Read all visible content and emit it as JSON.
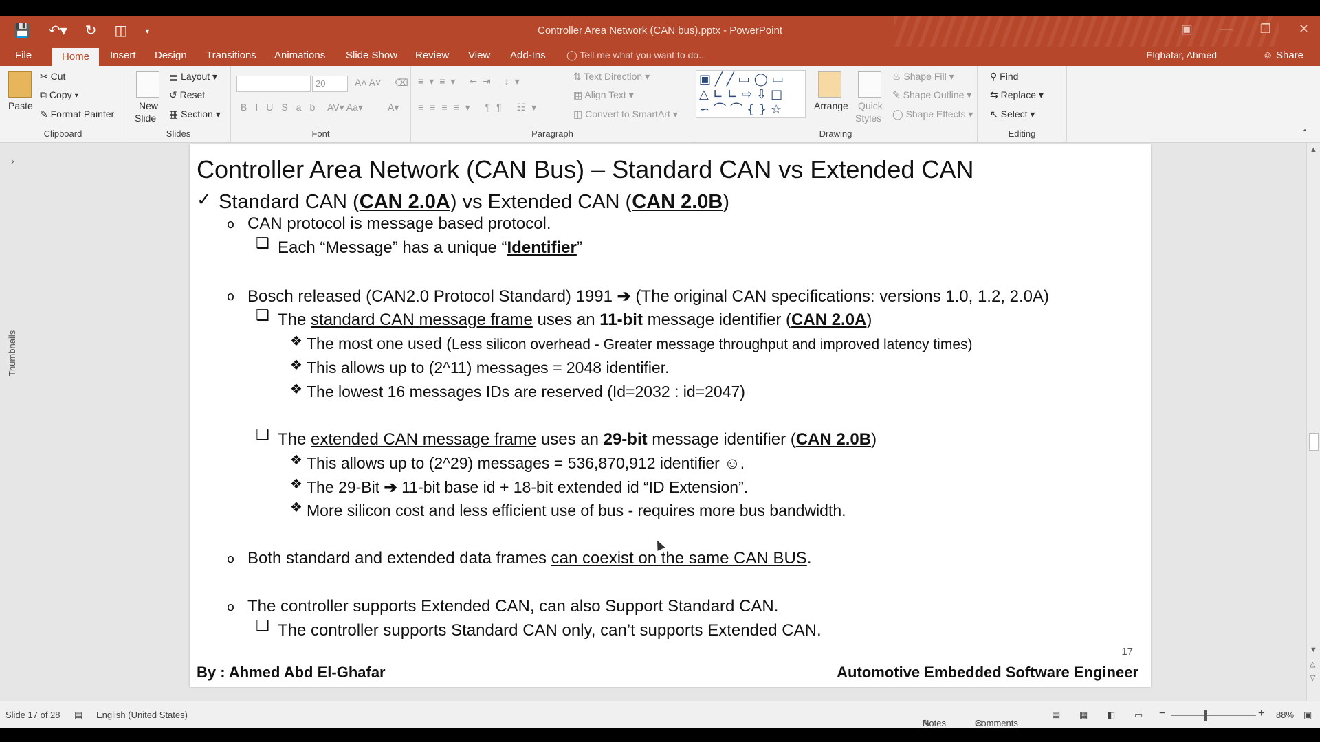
{
  "window": {
    "title": "Controller Area Network (CAN bus).pptx - PowerPoint",
    "icons": [
      "save-icon",
      "undo-icon",
      "redo-icon",
      "start-from-beginning-icon",
      "customize-qat-icon"
    ]
  },
  "menu": {
    "file": "File",
    "tabs": [
      "Home",
      "Insert",
      "Design",
      "Transitions",
      "Animations",
      "Slide Show",
      "Review",
      "View",
      "Add-Ins"
    ],
    "tell_me": "Tell me what you want to do...",
    "user": "Elghafar, Ahmed",
    "share": "Share"
  },
  "ribbon": {
    "clipboard": {
      "paste": "Paste",
      "cut": "Cut",
      "copy": "Copy",
      "format_painter": "Format Painter",
      "label": "Clipboard"
    },
    "slides": {
      "new_slide_1": "New",
      "new_slide_2": "Slide",
      "layout": "Layout",
      "reset": "Reset",
      "section": "Section",
      "label": "Slides"
    },
    "font": {
      "size": "20",
      "label": "Font"
    },
    "paragraph": {
      "text_direction": "Text Direction",
      "align_text": "Align Text",
      "convert_smartart": "Convert to SmartArt",
      "label": "Paragraph"
    },
    "drawing": {
      "arrange": "Arrange",
      "quick_styles_1": "Quick",
      "quick_styles_2": "Styles",
      "shape_fill": "Shape Fill",
      "shape_outline": "Shape Outline",
      "shape_effects": "Shape Effects",
      "label": "Drawing"
    },
    "editing": {
      "find": "Find",
      "replace": "Replace",
      "select": "Select",
      "label": "Editing"
    }
  },
  "thumbnails_label": "Thumbnails",
  "slide": {
    "title": "Controller Area Network (CAN Bus) – Standard CAN vs Extended CAN",
    "l1": {
      "a": "Standard CAN (",
      "b": "CAN 2.0A",
      "c": ") vs Extended CAN (",
      "d": "CAN 2.0B",
      "e": ")"
    },
    "l2": "CAN protocol is message based protocol.",
    "l3": {
      "a": "Each “Message” has a unique “",
      "b": "Identifier",
      "c": "”"
    },
    "l4": {
      "a": "Bosch released (CAN2.0 Protocol Standard) 1991 ",
      "arrow": "➔",
      "b": " (The original CAN specifications: versions 1.0, 1.2, 2.0A)"
    },
    "l5": {
      "a": "The ",
      "b": "standard CAN message frame",
      "c": " uses an ",
      "d": "11-bit",
      "e": " message identifier (",
      "f": "CAN 2.0A",
      "g": ")"
    },
    "l6": {
      "a": "The most one used (",
      "b": "Less silicon overhead - Greater message throughput and improved latency times)"
    },
    "l7": "This allows up to (2^11) messages = 2048 identifier.",
    "l8": "The lowest 16 messages IDs are reserved (Id=2032 : id=2047)",
    "l9": {
      "a": "The ",
      "b": "extended CAN message frame",
      "c": " uses an ",
      "d": "29-bit",
      "e": " message identifier (",
      "f": "CAN 2.0B",
      "g": ")"
    },
    "l10": "This allows up to (2^29) messages = 536,870,912 identifier ☺.",
    "l11": {
      "a": "The 29-Bit ",
      "arrow": "➔",
      "b": " 11-bit base id + 18-bit extended id “ID Extension”."
    },
    "l12": "More silicon cost and less efficient use of bus - requires more bus bandwidth.",
    "l13": {
      "a": "Both standard and extended data frames ",
      "b": "can coexist on the same CAN BUS",
      "c": "."
    },
    "l14": "The controller supports Extended CAN, can also Support Standard CAN.",
    "l15": "The controller supports Standard CAN only, can’t supports Extended CAN.",
    "page_number": "17",
    "footer_left": "By : Ahmed Abd El-Ghafar",
    "footer_right": "Automotive Embedded Software Engineer"
  },
  "status": {
    "slide_info": "Slide 17 of 28",
    "language": "English (United States)",
    "notes": "Notes",
    "comments": "Comments",
    "zoom": "88%"
  }
}
